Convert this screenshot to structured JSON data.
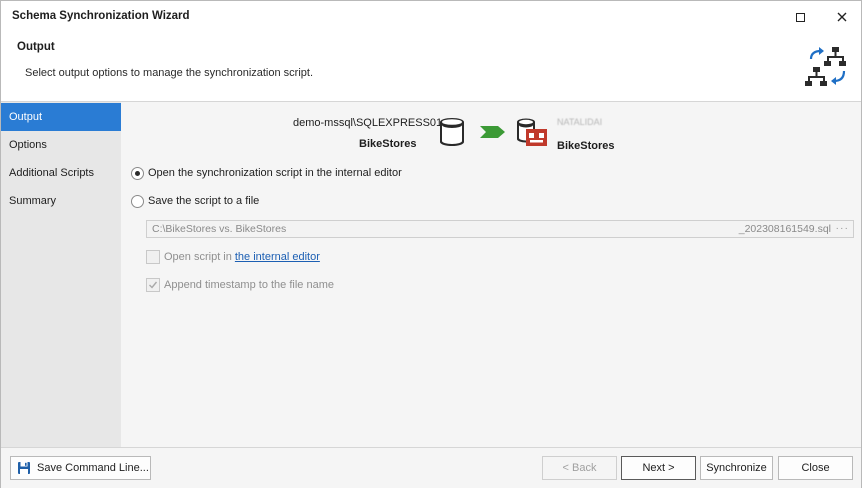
{
  "window": {
    "title": "Schema Synchronization Wizard"
  },
  "header": {
    "title": "Output",
    "description": "Select output options to manage the synchronization script.",
    "icon": "schema-sync-icon"
  },
  "nav": {
    "items": [
      {
        "label": "Output",
        "active": true
      },
      {
        "label": "Options",
        "active": false
      },
      {
        "label": "Additional Scripts",
        "active": false
      },
      {
        "label": "Summary",
        "active": false
      }
    ]
  },
  "connection": {
    "source_server": "demo-mssql\\SQLEXPRESS01",
    "source_database": "BikeStores",
    "target_server": "NATALIDAI",
    "target_database": "BikeStores",
    "arrow_color": "#3c9a36",
    "target_icon_color": "#c0392b"
  },
  "output": {
    "option_internal_editor": "Open the synchronization script in the internal editor",
    "option_save_file": "Save the script to a file",
    "selected": "internal_editor",
    "file_path_left": "C:\\BikeStores vs. BikeStores",
    "file_path_right": "_202308161549.sql",
    "browse": "···",
    "open_script_prefix": "Open script in",
    "open_script_link": "the internal editor",
    "open_script_checked": false,
    "append_timestamp": "Append timestamp to the file name",
    "append_timestamp_checked": true
  },
  "footer": {
    "save_command_line": "Save Command Line...",
    "back": "< Back",
    "next": "Next >",
    "synchronize": "Synchronize",
    "close": "Close",
    "back_enabled": false
  },
  "colors": {
    "accent": "#2a7cd4",
    "link": "#1c5fb3"
  }
}
